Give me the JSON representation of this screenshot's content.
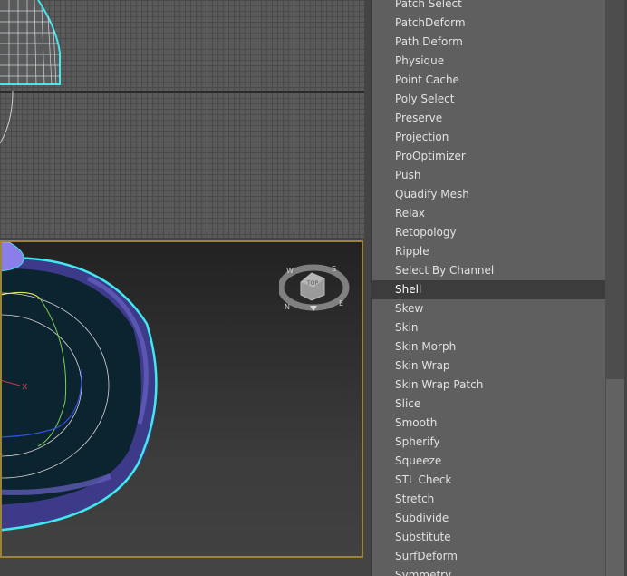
{
  "top_viewport": {
    "name": "top-viewport"
  },
  "perspective_viewport": {
    "name": "perspective-viewport",
    "axis_label": "x",
    "viewcube": {
      "face_label": "TOP",
      "compass": {
        "north": "N",
        "south": "S",
        "east": "E",
        "west": "W"
      }
    }
  },
  "modifier_list": {
    "selected": "Shell",
    "items": [
      "Patch Select",
      "PatchDeform",
      "Path Deform",
      "Physique",
      "Point Cache",
      "Poly Select",
      "Preserve",
      "Projection",
      "ProOptimizer",
      "Push",
      "Quadify Mesh",
      "Relax",
      "Retopology",
      "Ripple",
      "Select By Channel",
      "Shell",
      "Skew",
      "Skin",
      "Skin Morph",
      "Skin Wrap",
      "Skin Wrap Patch",
      "Slice",
      "Smooth",
      "Spherify",
      "Squeeze",
      "STL Check",
      "Stretch",
      "Subdivide",
      "Substitute",
      "SurfDeform",
      "Symmetry"
    ]
  },
  "colors": {
    "list_bg": "#5f5f5f",
    "selected_bg": "#3c3c3c",
    "active_viewport_border": "#9b8437",
    "object_wire": "#40e8f0",
    "object_fill": "#5a4fa8"
  }
}
